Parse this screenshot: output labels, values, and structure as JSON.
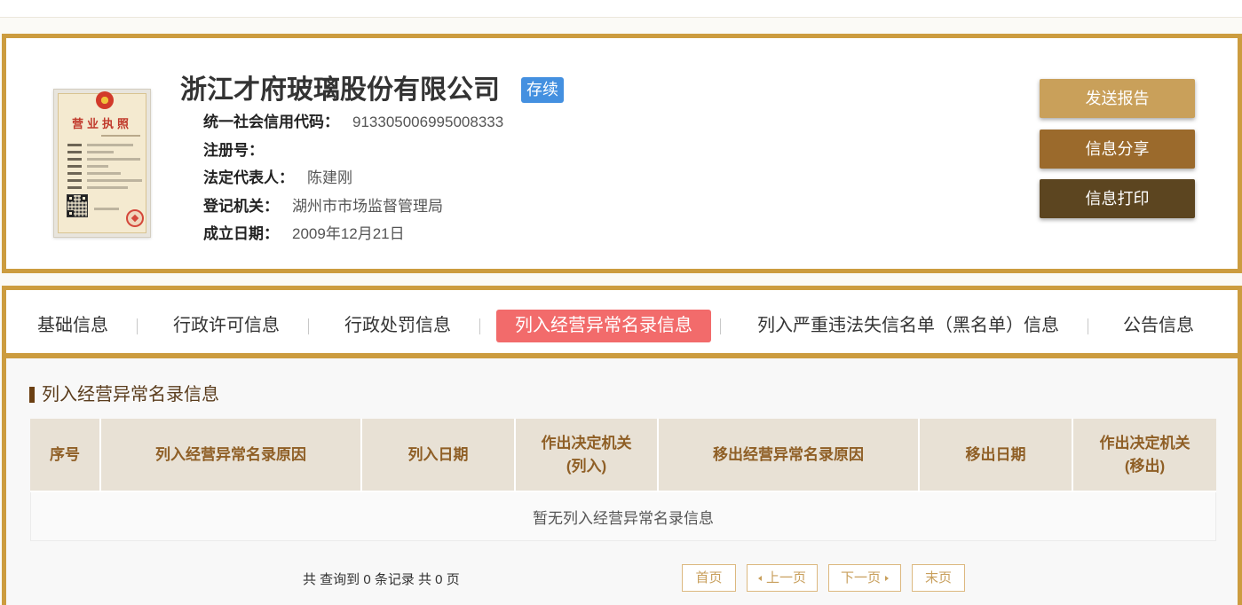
{
  "company": {
    "name": "浙江才府玻璃股份有限公司",
    "status": "存续",
    "license_title": "营业执照",
    "fields": [
      {
        "label": "统一社会信用代码：",
        "value": "913305006995008333"
      },
      {
        "label": "注册号："
      },
      {
        "label": "法定代表人：",
        "value": "陈建刚"
      },
      {
        "label": "登记机关：",
        "value": "湖州市市场监督管理局"
      },
      {
        "label": "成立日期：",
        "value": "2009年12月21日"
      }
    ]
  },
  "actions": {
    "send_report": "发送报告",
    "share": "信息分享",
    "print": "信息打印"
  },
  "tabs": [
    "基础信息",
    "行政许可信息",
    "行政处罚信息",
    "列入经营异常名录信息",
    "列入严重违法失信名单（黑名单）信息",
    "公告信息"
  ],
  "active_tab": 3,
  "section": {
    "title": "列入经营异常名录信息"
  },
  "table": {
    "columns": [
      {
        "label": "序号"
      },
      {
        "label": "列入经营异常名录原因"
      },
      {
        "label": "列入日期"
      },
      {
        "label": "作出决定机关",
        "sub": "(列入)"
      },
      {
        "label": "移出经营异常名录原因"
      },
      {
        "label": "移出日期"
      },
      {
        "label": "作出决定机关",
        "sub": "(移出)"
      }
    ],
    "empty_message": "暂无列入经营异常名录信息"
  },
  "pagination": {
    "summary": "共 查询到 0 条记录 共 0 页",
    "first": "首页",
    "prev": "上一页",
    "next": "下一页",
    "last": "末页"
  },
  "icons": {
    "prev": "triangle-left-icon",
    "next": "triangle-right-icon",
    "license": "business-license-image"
  },
  "colors": {
    "brand_gold": "#cc9c3f",
    "status_badge": "#4490e0",
    "active_tab": "#f26b6b",
    "send_report_button": "#c9a05a",
    "share_button": "#9b6a2c",
    "print_button": "#5c4520"
  }
}
